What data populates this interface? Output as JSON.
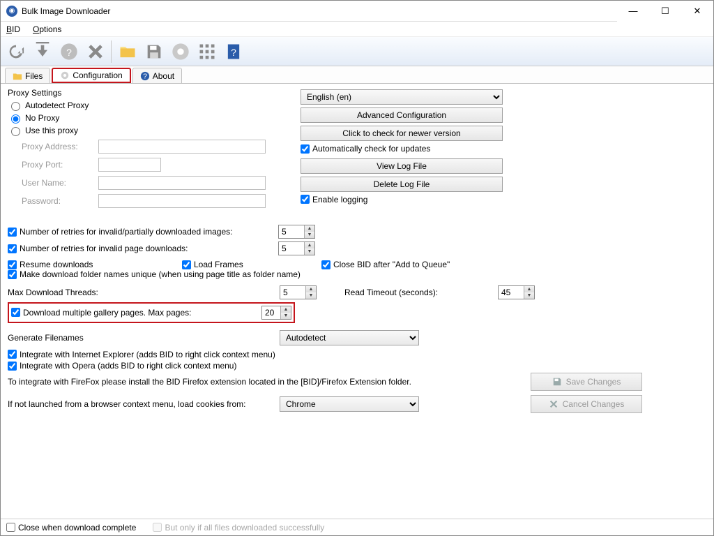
{
  "titlebar": {
    "title": "Bulk Image Downloader"
  },
  "menubar": {
    "bid": "BID",
    "options": "Options"
  },
  "tabs": {
    "files": "Files",
    "config": "Configuration",
    "about": "About"
  },
  "proxy": {
    "legend": "Proxy Settings",
    "autodetect": "Autodetect Proxy",
    "noproxy": "No Proxy",
    "usethis": "Use this proxy",
    "addr_label": "Proxy Address:",
    "port_label": "Proxy Port:",
    "user_label": "User Name:",
    "pass_label": "Password:"
  },
  "right": {
    "language": "English (en)",
    "advanced": "Advanced Configuration",
    "checknew": "Click to check for newer version",
    "autoupd": "Automatically check for updates",
    "viewlog": "View Log File",
    "dellog": "Delete Log File",
    "enablelog": "Enable logging"
  },
  "retries": {
    "invalidimg": "Number of retries for invalid/partially downloaded images:",
    "invalidimg_val": "5",
    "invalidpage": "Number of retries for invalid page downloads:",
    "invalidpage_val": "5"
  },
  "opts": {
    "resume": "Resume downloads",
    "loadframes": "Load Frames",
    "closeafter": "Close BID after \"Add to Queue\"",
    "unique": "Make download folder names unique (when using page title as folder name)",
    "maxthreads_label": "Max Download Threads:",
    "maxthreads_val": "5",
    "readtimeout_label": "Read Timeout (seconds):",
    "readtimeout_val": "45",
    "multipage": "Download multiple gallery pages. Max pages:",
    "multipage_val": "20"
  },
  "gen": {
    "label": "Generate Filenames",
    "value": "Autodetect"
  },
  "integrate": {
    "ie": "Integrate with Internet Explorer (adds BID to right click context menu)",
    "opera": "Integrate with Opera (adds BID to right click context menu)",
    "firefox": "To integrate with FireFox please install the BID Firefox extension located in the [BID]/Firefox Extension folder.",
    "cookies_label": "If not launched from a browser context menu, load cookies from:",
    "cookies_value": "Chrome"
  },
  "buttons": {
    "save": "Save Changes",
    "cancel": "Cancel Changes"
  },
  "bottom": {
    "closewhen": "Close when download complete",
    "butonly": "But only if all files downloaded successfully"
  }
}
